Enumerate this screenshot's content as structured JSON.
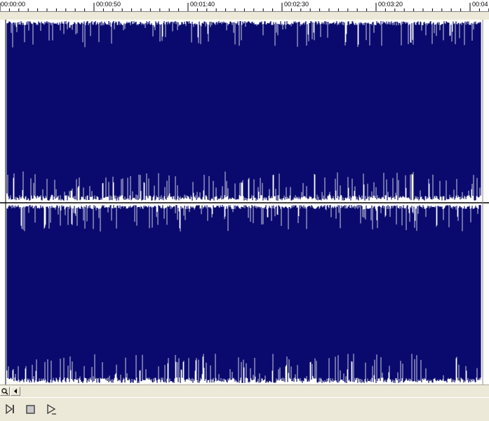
{
  "ruler": {
    "ticks": [
      "00:00:00",
      "00:00:50",
      "00:01:40",
      "00:02:30",
      "00:03:20",
      "00:04"
    ]
  },
  "waveform": {
    "channels": [
      "left-channel",
      "right-channel"
    ],
    "fill_color": "#0a0a6e",
    "background_color": "#ffffff"
  },
  "scrollbar": {
    "zoom_icon": "magnifier-icon",
    "left_icon": "arrow-left-icon"
  },
  "transport": {
    "buttons": [
      "skip-to-end-icon",
      "stop-icon",
      "play-icon"
    ]
  }
}
